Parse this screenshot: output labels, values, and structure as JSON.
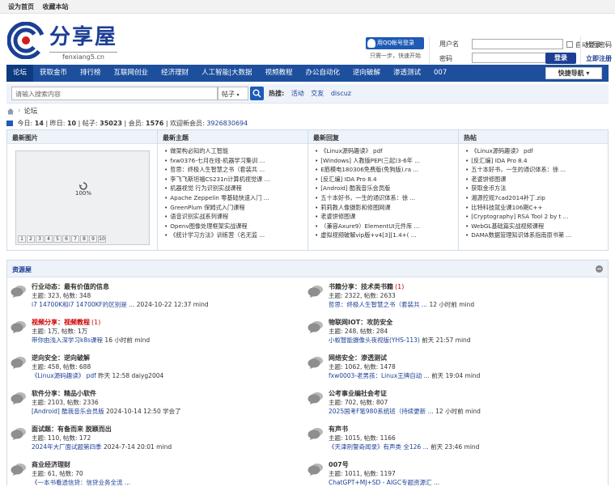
{
  "topbar": {
    "home": "设为首页",
    "fav": "收藏本站"
  },
  "logo": {
    "title": "分享屋",
    "url": "fenxiang5.cn"
  },
  "qq": {
    "button": "用QQ帐号登录",
    "sub": "只需一步，快速开始"
  },
  "login": {
    "user_label": "用户名",
    "pass_label": "密码",
    "auto": "自动登录",
    "find_pw": "找回密码",
    "login_btn": "登录",
    "register": "立即注册"
  },
  "nav": {
    "items": [
      "论坛",
      "获取金币",
      "排行榜",
      "互联网创业",
      "经济理财",
      "人工智能|大数据",
      "视频教程",
      "办公自动化",
      "逆向破解",
      "渗透测试",
      "007"
    ],
    "quick": "快捷导航"
  },
  "search": {
    "placeholder": "请输入搜索内容",
    "type": "帖子",
    "hot_label": "热搜:",
    "hot": [
      "活动",
      "交友",
      "discuz"
    ]
  },
  "breadcrumb": {
    "current": "论坛"
  },
  "stats": {
    "today_l": "今日:",
    "today": "14",
    "yday_l": "昨日:",
    "yday": "10",
    "posts_l": "帖子:",
    "posts": "35023",
    "members_l": "会员:",
    "members": "1576",
    "welcome_l": "欢迎新会员:",
    "welcome": "3926830694"
  },
  "panels": {
    "img_title": "最新图片",
    "img_pct": "100%",
    "pager": [
      "1",
      "2",
      "3",
      "4",
      "5",
      "6",
      "7",
      "8",
      "9",
      "10"
    ],
    "topics_title": "最新主题",
    "topics": [
      "做架构必知的人工智能",
      "fxw0376-七月在线-机器学习集训 ...",
      "哲思：终极人生智慧之书（套装共 ...",
      "李飞飞斯坦福CS231n计算机视觉课 ...",
      "机器视觉 行为识别实战课程",
      "Apache Zeppelin 零基础快速入门 ...",
      "GreenPlum 保姆式入门课程",
      "语音识别实战系列课程",
      "Openv图像处理框架实战课程",
      "《统计学习方法》训练营（名无监 ..."
    ],
    "replies_title": "最新回复",
    "replies": [
      "《Linux源码趣读》 pdf",
      "[Windows] 人教版PEP(三起)3-6年 ...",
      "E筋模电180306免费版(免狗版).ra ...",
      "[反汇编] IDA Pro 8.4",
      "[Android] 酷我音乐会员版",
      "五十本好书，一生的通识体系：徐 ...",
      "莉莉教人像摄影和修图网课",
      "老婆饼修图课",
      "（兼容Axure9）ElementUI元件库 ...",
      "虚拟视频破解vip版+v4[3][1.4+( ..."
    ],
    "hot_title": "热帖",
    "hot": [
      "《Linux源码趣读》 pdf",
      "[反汇编] IDA Pro 8.4",
      "五十本好书，一生的通识体系：徐 ...",
      "老婆饼修图课",
      "获取金币方法",
      "湘源控规7cad2014补丁.zip",
      "比特科技就业课106期C++",
      "[Cryptography] RSA Tool 2 by t ...",
      "WebGL基础篇实战视频课程",
      "DAMA数据管理知识体系指南原书第 ..."
    ]
  },
  "forum": {
    "title": "资源屋",
    "boards": [
      {
        "name": "行业动态：最有价值的信息",
        "new": "",
        "count": "主题: 323, 帖数: 348",
        "last_title": "i7 14700K和i7 14700KF的区别是 ...",
        "last_meta": "2024-10-22 12:37 mind"
      },
      {
        "name": "书籍分享：技术类书籍",
        "new": "(1)",
        "count": "主题: 2322, 帖数: 2633",
        "last_title": "哲思：终极人生智慧之书（套装共 ...",
        "last_meta": "12 小时前 mind"
      },
      {
        "name": "视频分享：视频教程",
        "new": "(1)",
        "count": "主题: 1万, 帖数: 1万",
        "last_title": "带你由浅入深学习k8s课程",
        "last_meta": "16 小时前 mind"
      },
      {
        "name": "物联网IOT：攻防安全",
        "new": "",
        "count": "主题: 248, 帖数: 284",
        "last_title": "小蚁智能摄像头夜视版(YHS-113)",
        "last_meta": "前天 21:57 mind"
      },
      {
        "name": "逆向安全：逆向破解",
        "new": "",
        "count": "主题: 458, 帖数: 688",
        "last_title": "《Linux源码趣读》 pdf",
        "last_meta": "昨天 12:58 daiyg2004"
      },
      {
        "name": "网络安全：渗透测试",
        "new": "",
        "count": "主题: 1062, 帖数: 1478",
        "last_title": "fxw0003-老男孩：Linux王牌自动 ...",
        "last_meta": "前天 19:04 mind"
      },
      {
        "name": "软件分享：精品小软件",
        "new": "",
        "count": "主题: 2103, 帖数: 2336",
        "last_title": "[Android] 酷我音乐会员版",
        "last_meta": "2024-10-14 12:50 学会了"
      },
      {
        "name": "公考事业编社会考证",
        "new": "",
        "count": "主题: 702, 帖数: 807",
        "last_title": "2025国考F笔980系统班（持续更新 ...",
        "last_meta": "12 小时前 mind"
      },
      {
        "name": "面试题：有备而来 脱颖而出",
        "new": "",
        "count": "主题: 110, 帖数: 172",
        "last_title": "2024年大厂面试题第四季",
        "last_meta": "2024-7-14 20:01 mind"
      },
      {
        "name": "有声书",
        "new": "",
        "count": "主题: 1015, 帖数: 1166",
        "last_title": "《天津刑警奇闻录》有声类 全126 ...",
        "last_meta": "前天 23:46 mind"
      },
      {
        "name": "商业经济理财",
        "new": "",
        "count": "主题: 61, 帖数: 70",
        "last_title": "《一本书看透信贷：信贷业务全流 ...",
        "last_meta": ""
      },
      {
        "name": "007号",
        "new": "",
        "count": "主题: 1011, 帖数: 1197",
        "last_title": "ChatGPT+MJ+SD - AIGC专题资源汇 ...",
        "last_meta": ""
      }
    ]
  }
}
